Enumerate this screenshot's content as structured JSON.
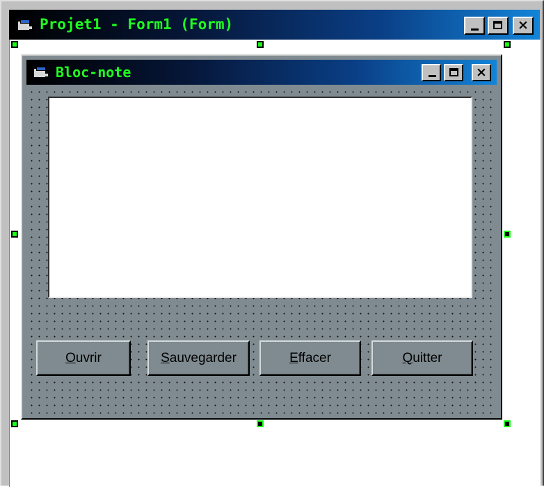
{
  "outer_window": {
    "title": "Projet1 - Form1 (Form)",
    "controls": [
      "minimize",
      "maximize",
      "close"
    ],
    "close_glyph": "×"
  },
  "form": {
    "title": "Bloc-note",
    "close_glyph": "×",
    "text_area_value": "",
    "buttons": [
      {
        "mnemonic": "O",
        "rest": "uvrir"
      },
      {
        "mnemonic": "S",
        "rest": "auvegarder"
      },
      {
        "mnemonic": "E",
        "rest": "ffacer"
      },
      {
        "mnemonic": "Q",
        "rest": "uitter"
      }
    ]
  },
  "colors": {
    "title_text": "#20ff20",
    "form_background": "#7f8b90",
    "handle_fill": "#18ff18"
  },
  "icons": {
    "window_icon": "form-window-icon",
    "minimize": "minimize-icon",
    "maximize": "maximize-icon",
    "close": "close-icon"
  }
}
